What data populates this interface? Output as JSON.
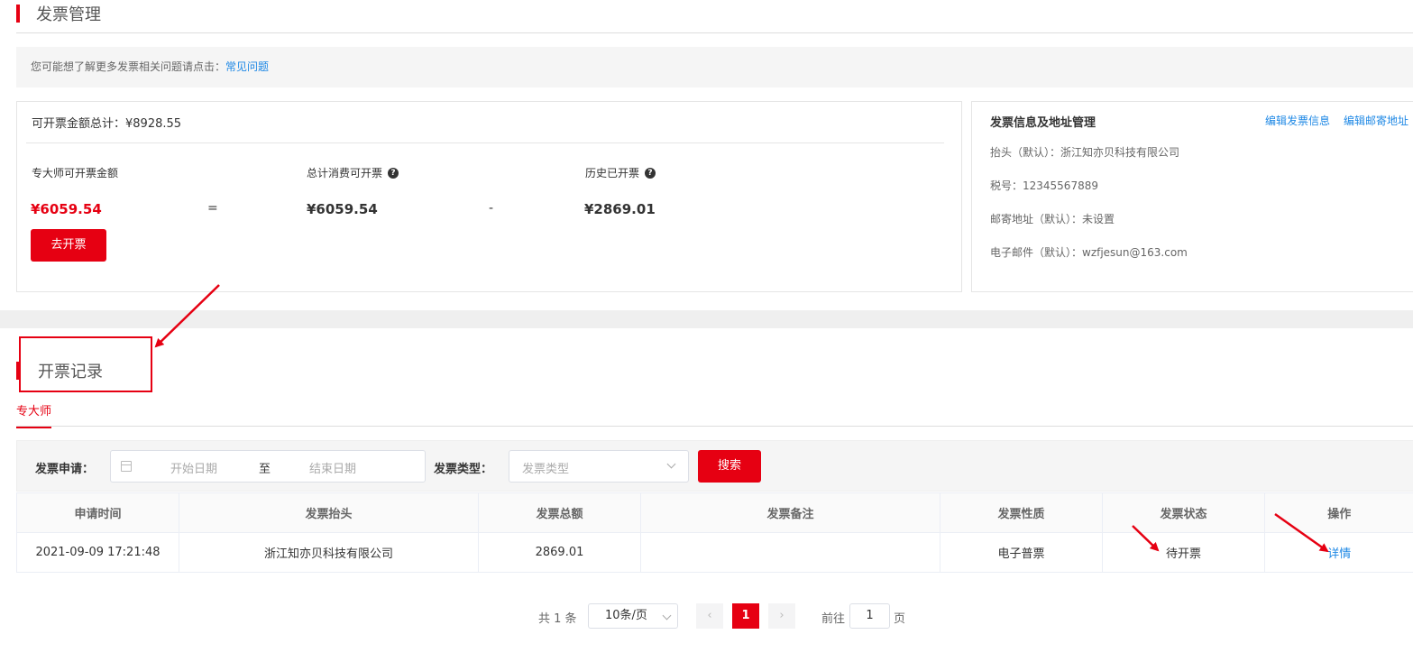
{
  "page": {
    "title": "发票管理"
  },
  "tip": {
    "text": "您可能想了解更多发票相关问题请点击：",
    "link": "常见问题"
  },
  "summary": {
    "total_label": "可开票金额总计：¥8928.55",
    "col1_label": "专大师可开票金额",
    "col1_value": "¥6059.54",
    "op1": "=",
    "col2_label": "总计消费可开票",
    "col2_value": "¥6059.54",
    "op2": "-",
    "col3_label": "历史已开票",
    "col3_value": "¥2869.01",
    "issue_button": "去开票"
  },
  "invoice_info": {
    "title": "发票信息及地址管理",
    "edit_invoice_link": "编辑发票信息",
    "edit_mail_link": "编辑邮寄地址",
    "header_line": "抬头（默认）：浙江知亦贝科技有限公司",
    "tax_line": "税号：12345567889",
    "address_line": "邮寄地址（默认）：未设置",
    "email_line": "电子邮件（默认）：wzfjesun@163.com"
  },
  "records": {
    "title": "开票记录",
    "tab": "专大师"
  },
  "filter": {
    "apply_label": "发票申请：",
    "start_placeholder": "开始日期",
    "range_sep": "至",
    "end_placeholder": "结束日期",
    "type_label": "发票类型：",
    "type_placeholder": "发票类型",
    "search_button": "搜索"
  },
  "table": {
    "headers": [
      "申请时间",
      "发票抬头",
      "发票总额",
      "发票备注",
      "发票性质",
      "发票状态",
      "操作"
    ],
    "rows": [
      {
        "time": "2021-09-09 17:21:48",
        "header": "浙江知亦贝科技有限公司",
        "total": "2869.01",
        "remark": "",
        "nature": "电子普票",
        "status": "待开票",
        "action": "详情"
      }
    ]
  },
  "pager": {
    "total": "共 1 条",
    "page_size": "10条/页",
    "prev": "‹",
    "current": "1",
    "next": "›",
    "goto": "前往",
    "jump_value": "1",
    "page_unit": "页"
  },
  "colors": {
    "accent": "#e60012",
    "link": "#1e88e5"
  }
}
